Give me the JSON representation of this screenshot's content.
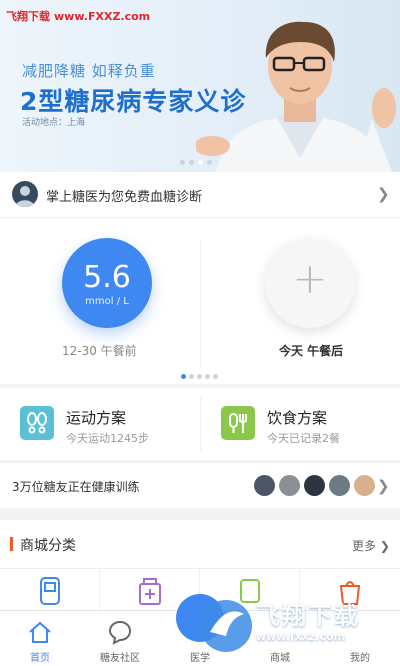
{
  "watermark": {
    "site_name": "飞翔下载",
    "site_url": "www.FXXZ.com"
  },
  "banner": {
    "subtitle": "减肥降糖  如释负重",
    "title": "2型糖尿病专家义诊",
    "location": "活动地点：上海",
    "carousel_count": 4,
    "carousel_active": 2
  },
  "doctor_row": {
    "text": "掌上糖医为您免费血糖诊断"
  },
  "glucose": {
    "value": "5.6",
    "unit": "mmol / L",
    "time": "12-30 午餐前"
  },
  "add_record": {
    "label": "今天 午餐后"
  },
  "pager": {
    "count": 5,
    "active": 0
  },
  "plans": {
    "exercise": {
      "title": "运动方案",
      "subtitle": "今天运动1245步"
    },
    "diet": {
      "title": "饮食方案",
      "subtitle": "今天已记录2餐"
    }
  },
  "friends": {
    "text": "3万位糖友正在健康训练"
  },
  "mall": {
    "title": "商城分类",
    "more": "更多"
  },
  "tabs": [
    {
      "label": "首页",
      "icon": "home-icon",
      "active": true
    },
    {
      "label": "糖友社区",
      "icon": "chat-bubble-icon",
      "active": false
    },
    {
      "label": "医学",
      "icon": "medical-icon",
      "active": false
    },
    {
      "label": "商城",
      "icon": "shop-icon",
      "active": false
    },
    {
      "label": "我的",
      "icon": "user-icon",
      "active": false
    }
  ],
  "logo_watermark": {
    "name": "飞翔下载",
    "url": "www.fxxz.com"
  },
  "colors": {
    "accent_blue": "#3f87f1",
    "banner_title": "#1f6fcf",
    "exercise_icon": "#5bc0d6",
    "diet_icon": "#8bc84a",
    "mall_bar": "#f05a28",
    "watermark_red": "#e0262a"
  }
}
